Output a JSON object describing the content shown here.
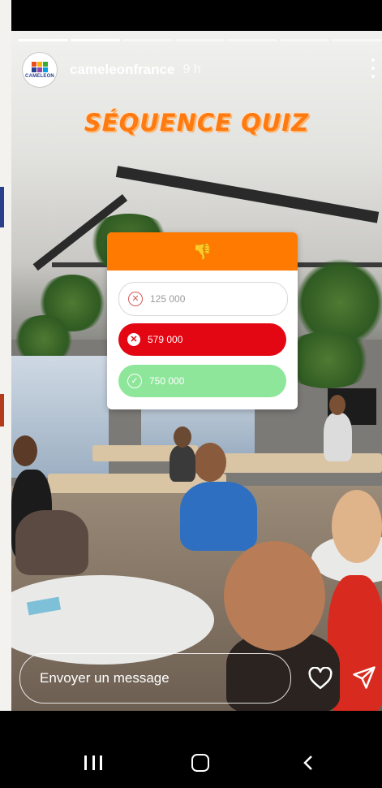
{
  "story": {
    "username": "cameleonfrance",
    "time_ago": "9 h",
    "avatar_text": "CAMELEON",
    "progress_total": 7,
    "progress_done": 2
  },
  "quiz": {
    "title": "SÉQUENCE QUIZ",
    "header_emoji": "👎",
    "options": [
      {
        "label": "125 000",
        "state": "unselected"
      },
      {
        "label": "579 000",
        "state": "selected-wrong"
      },
      {
        "label": "750 000",
        "state": "correct"
      }
    ]
  },
  "reply": {
    "placeholder": "Envoyer un message"
  },
  "icons": {
    "heart": "heart-icon",
    "send": "send-icon",
    "more": "more-icon",
    "recent": "recent-apps-icon",
    "home": "home-icon",
    "back": "back-icon"
  },
  "colors": {
    "quiz_orange": "#ff7a00",
    "wrong_red": "#e30613",
    "correct_green": "#8ee69a"
  }
}
